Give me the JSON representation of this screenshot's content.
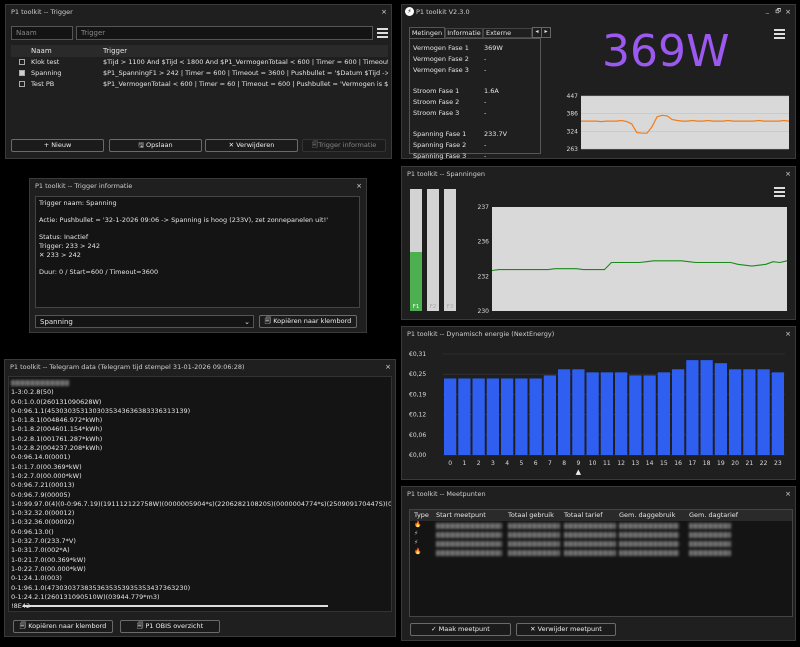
{
  "trigger_win": {
    "title": "P1 toolkit -- Trigger",
    "close": "×",
    "name_placeholder": "Naam",
    "trigger_placeholder": "Trigger",
    "col_name": "Naam",
    "col_trigger": "Trigger",
    "rows": [
      {
        "name": "Klok test",
        "trigger": "$Tijd > 1100 And $Tijd < 1800 And $P1_VermogenTotaal < 600 | Timer = 600 | Timeout = 600 ...",
        "checked": false
      },
      {
        "name": "Spanning",
        "trigger": "$P1_SpanningF1 > 242 | Timer = 600 | Timeout = 3600 | Pushbullet = '$Datum $Tijd -> Spann...",
        "checked": true
      },
      {
        "name": "Test PB",
        "trigger": "$P1_VermogenTotaal < 600 | Timer = 60 | Timeout = 600 | Pushbullet = 'Vermogen is $P1_Ver...",
        "checked": false
      }
    ],
    "btn_new": "+ Nieuw",
    "btn_save": "🖫 Opslaan",
    "btn_delete": "✕ Verwijderen",
    "btn_info": "🗐Trigger informatie"
  },
  "info_win": {
    "title": "P1 toolkit -- Trigger informatie",
    "close": "×",
    "lines": [
      "Trigger naam: Spanning",
      "",
      "Actie: Pushbullet = '32-1-2026 09:06 -> Spanning is hoog (233V), zet zonnepanelen uit!'",
      "",
      "Status: Inactief",
      "Trigger: 233 > 242",
      "✕ 233 > 242",
      "",
      "Duur: 0 / Start=600 / Timeout=3600"
    ],
    "select_value": "Spanning",
    "btn_copy": "🗐 Kopiëren naar klembord"
  },
  "telegram_win": {
    "title": "P1 toolkit -- Telegram data (Telegram tijd stempel 31-01-2026 09:06:28)",
    "close": "×",
    "lines": [
      "1-3:0.2.8(50)",
      "0-0:1.0.0(260131090628W)",
      "0-0:96.1.1(4530303531303035343636383336313139)",
      "1-0:1.8.1(004846.972*kWh)",
      "1-0:1.8.2(004601.154*kWh)",
      "1-0:2.8.1(001761.287*kWh)",
      "1-0:2.8.2(004237.208*kWh)",
      "0-0:96.14.0(0001)",
      "1-0:1.7.0(00.369*kW)",
      "1-0:2.7.0(00.000*kW)",
      "0-0:96.7.21(00013)",
      "0-0:96.7.9(00005)",
      "1-0:99.97.0(4)(0-0:96.7.19)(191112122758W)(0000005904*s)(220628210820S)(0000004774*s)(250909170447S)(0000005641*s)(2601140",
      "1-0:32.32.0(00012)",
      "1-0:32.36.0(00002)",
      "0-0:96.13.0()",
      "1-0:32.7.0(233.7*V)",
      "1-0:31.7.0(002*A)",
      "1-0:21.7.0(00.369*kW)",
      "1-0:22.7.0(00.000*kW)",
      "0-1:24.1.0(003)",
      "0-1:96.1.0(4730303738353635353935353437363230)",
      "0-1:24.2.1(260131090510W)(03944.779*m3)",
      "!8E42"
    ],
    "btn_copy": "🗐 Kopiëren naar klembord",
    "btn_obis": "🗐 P1 OBIS overzicht"
  },
  "main_win": {
    "title": "P1 toolkit V2.3.0",
    "close": "×",
    "minimize": "_",
    "restore": "🗗",
    "tabs": [
      "Metingen",
      "Informatie",
      "Externe metingen"
    ],
    "tab_arrow_left": "◂",
    "tab_arrow_right": "▸",
    "metrics": [
      {
        "label": "Vermogen Fase 1",
        "value": "369W"
      },
      {
        "label": "Vermogen Fase 2",
        "value": "-"
      },
      {
        "label": "Vermogen Fase 3",
        "value": "-"
      },
      {
        "label": "",
        "value": ""
      },
      {
        "label": "Stroom Fase 1",
        "value": "1.6A"
      },
      {
        "label": "Stroom Fase 2",
        "value": "-"
      },
      {
        "label": "Stroom Fase 3",
        "value": "-"
      },
      {
        "label": "",
        "value": ""
      },
      {
        "label": "Spanning Fase 1",
        "value": "233.7V"
      },
      {
        "label": "Spanning Fase 2",
        "value": "-"
      },
      {
        "label": "Spanning Fase 3",
        "value": "-"
      }
    ],
    "big_value": "369W",
    "big_color": "#9b59f0",
    "mini_chart_yticks": [
      "447",
      "386",
      "324",
      "263"
    ]
  },
  "voltage_win": {
    "title": "P1 toolkit -- Spanningen",
    "close": "×",
    "bars": [
      {
        "label": "F1",
        "fill": 0.48,
        "color": "#4caf50"
      },
      {
        "label": "F2",
        "fill": 0,
        "color": "#4caf50"
      },
      {
        "label": "F3",
        "fill": 0,
        "color": "#4caf50"
      }
    ],
    "yticks": [
      "237",
      "236",
      "232",
      "230"
    ]
  },
  "energy_win": {
    "title": "P1 toolkit -- Dynamisch energie (NextEnergy)",
    "close": "×",
    "bar_color": "#2f5ff0",
    "marker": "▲",
    "marker_hour": 9
  },
  "meet_win": {
    "title": "P1 toolkit -- Meetpunten",
    "close": "×",
    "columns": [
      "Type",
      "Start meetpunt",
      "Totaal gebruik",
      "Totaal tarief",
      "Gem. daggebruik",
      "Gem. dagtarief"
    ],
    "row_icons": [
      "🔥",
      "⚡",
      "⚡",
      "🔥"
    ],
    "btn_make": "✓ Maak meetpunt",
    "btn_remove": "✕ Verwijder meetpunt"
  },
  "chart_data": [
    {
      "type": "line",
      "title": "",
      "ylim": [
        263,
        447
      ],
      "yticks": [
        447,
        386,
        324,
        263
      ],
      "series": [
        {
          "values": [
            360,
            360,
            360,
            360,
            358,
            360,
            360,
            360,
            362,
            358,
            350,
            320,
            318,
            318,
            340,
            375,
            380,
            378,
            365,
            362,
            360,
            360,
            362,
            360,
            360,
            362,
            360,
            360,
            360,
            362,
            360,
            360,
            360,
            360,
            360,
            362,
            360,
            360,
            360,
            360,
            362,
            360
          ],
          "color": "#f07c1a"
        }
      ]
    },
    {
      "type": "line",
      "title": "",
      "ylim": [
        230,
        237
      ],
      "yticks": [
        237,
        236,
        232,
        230
      ],
      "series": [
        {
          "values": [
            232.7,
            232.8,
            232.8,
            232.8,
            232.8,
            232.8,
            232.8,
            232.8,
            232.8,
            232.9,
            232.9,
            232.9,
            232.9,
            232.8,
            232.8,
            232.8,
            232.8,
            233.6,
            233.6,
            233.6,
            233.6,
            233.6,
            233.7,
            233.8,
            233.8,
            233.8,
            233.8,
            233.8,
            233.7,
            233.6,
            233.6,
            233.6,
            233.6,
            233.6,
            233.6,
            233.4,
            233.3,
            233.2,
            233.3,
            233.4,
            233.7,
            233.6,
            233.8
          ],
          "color": "#1a8a1a"
        }
      ]
    },
    {
      "type": "bar",
      "title": "",
      "categories": [
        "0",
        "1",
        "2",
        "3",
        "4",
        "5",
        "6",
        "7",
        "8",
        "9",
        "10",
        "11",
        "12",
        "13",
        "14",
        "15",
        "16",
        "17",
        "18",
        "19",
        "20",
        "21",
        "22",
        "23"
      ],
      "values": [
        0.25,
        0.25,
        0.25,
        0.25,
        0.25,
        0.25,
        0.25,
        0.26,
        0.28,
        0.28,
        0.27,
        0.27,
        0.27,
        0.26,
        0.26,
        0.27,
        0.28,
        0.31,
        0.31,
        0.3,
        0.28,
        0.28,
        0.28,
        0.27
      ],
      "ylim": [
        0,
        0.33
      ],
      "yticks": [
        "€0,31",
        "€0,25",
        "€0,19",
        "€0,12",
        "€0,06",
        "€0,00"
      ]
    }
  ]
}
